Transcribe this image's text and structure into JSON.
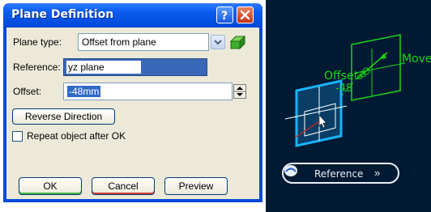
{
  "dialog": {
    "title": "Plane Definition",
    "plane_type_label": "Plane type:",
    "plane_type_value": "Offset from plane",
    "reference_label": "Reference:",
    "reference_value": "yz plane",
    "offset_label": "Offset:",
    "offset_value": "-48mm",
    "reverse_direction_label": "Reverse Direction",
    "repeat_label": "Repeat object after OK",
    "repeat_checked": false,
    "ok_label": "OK",
    "cancel_label": "Cancel",
    "preview_label": "Preview"
  },
  "viewport": {
    "move_label": "Move",
    "offset_label": "Offset",
    "offset_value": "-48",
    "reference_label": "Reference",
    "chevron": "»"
  },
  "colors": {
    "titlebar": "#0a5df2",
    "dialog_bg": "#ece9d8",
    "viewport_bg": "#001a33",
    "plane_green": "#19d419",
    "plane_cyan": "#19b3ff"
  },
  "icons": [
    "help-icon",
    "close-icon",
    "dropdown-arrow-icon",
    "plane-tool-icon",
    "spin-up-icon",
    "spin-down-icon",
    "reference-icon",
    "chevron-right-icon"
  ]
}
